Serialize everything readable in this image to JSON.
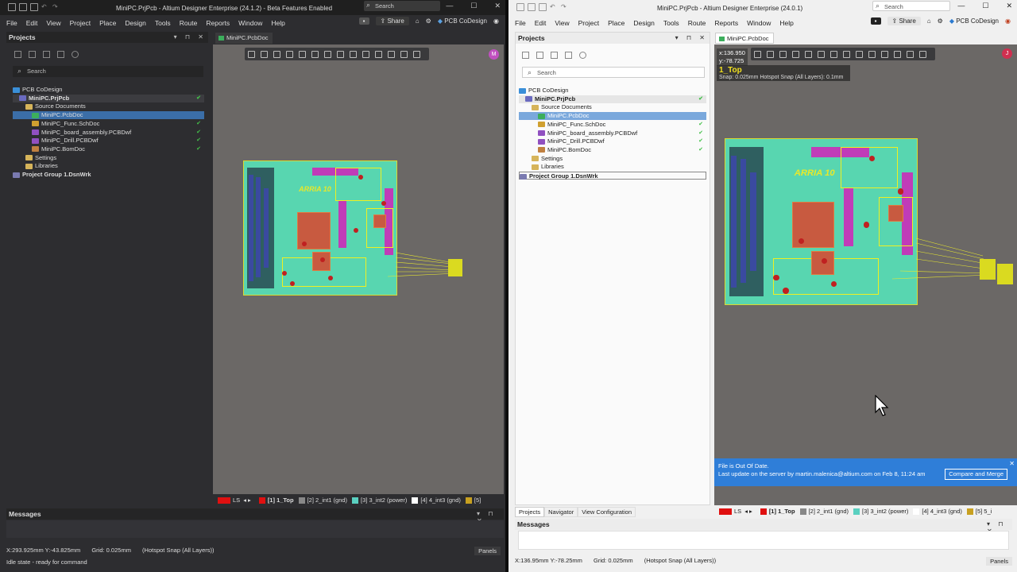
{
  "left": {
    "title": "MiniPC.PrjPcb - Altium Designer Enterprise (24.1.2) - Beta Features Enabled",
    "search_placeholder": "Search",
    "menu": [
      "File",
      "Edit",
      "View",
      "Project",
      "Place",
      "Design",
      "Tools",
      "Route",
      "Reports",
      "Window",
      "Help"
    ],
    "share_label": "Share",
    "codesign_label": "PCB CoDesign",
    "projects_title": "Projects",
    "panel_search": "Search",
    "tree": [
      {
        "label": "PCB CoDesign",
        "indent": 0,
        "icon": "cloud-icon",
        "check": false,
        "selected": false,
        "bold": false
      },
      {
        "label": "MiniPC.PrjPcb",
        "indent": 1,
        "icon": "project-icon",
        "check": true,
        "selected": false,
        "bold": true,
        "highlight": true
      },
      {
        "label": "Source Documents",
        "indent": 2,
        "icon": "folder-icon",
        "check": false,
        "selected": false,
        "bold": false
      },
      {
        "label": "MiniPC.PcbDoc",
        "indent": 3,
        "icon": "pcb-doc-icon",
        "check": false,
        "selected": true,
        "bold": false
      },
      {
        "label": "MiniPC_Func.SchDoc",
        "indent": 3,
        "icon": "sch-doc-icon",
        "check": true,
        "selected": false,
        "bold": false
      },
      {
        "label": "MiniPC_board_assembly.PCBDwf",
        "indent": 3,
        "icon": "draftsman-icon",
        "check": true,
        "selected": false,
        "bold": false
      },
      {
        "label": "MiniPC_Drill.PCBDwf",
        "indent": 3,
        "icon": "draftsman-icon",
        "check": true,
        "selected": false,
        "bold": false
      },
      {
        "label": "MiniPC.BomDoc",
        "indent": 3,
        "icon": "bom-icon",
        "check": true,
        "selected": false,
        "bold": false
      },
      {
        "label": "Settings",
        "indent": 2,
        "icon": "folder-icon",
        "check": false,
        "selected": false,
        "bold": false
      },
      {
        "label": "Libraries",
        "indent": 2,
        "icon": "folder-icon",
        "check": false,
        "selected": false,
        "bold": false
      },
      {
        "label": "Project Group 1.DsnWrk",
        "indent": 0,
        "icon": "workspace-icon",
        "check": false,
        "selected": false,
        "bold": true
      }
    ],
    "doc_tab": "MiniPC.PcbDoc",
    "board_label": "ARRIA 10",
    "avatar": "M",
    "layers": [
      "LS",
      "[1] 1_Top",
      "[2] 2_int1 (gnd)",
      "[3] 3_int2 (power)",
      "[4] 4_int3 (gnd)",
      "[5]"
    ],
    "layer_colors": [
      "#e01010",
      "#e01010",
      "#888888",
      "#5ad0c0",
      "#ffffff",
      "#c8a020"
    ],
    "messages_title": "Messages",
    "status_coords": "X:293.925mm Y:-43.825mm",
    "status_grid": "Grid: 0.025mm",
    "status_snap": "(Hotspot Snap (All Layers))",
    "status_idle": "Idle state - ready for command",
    "panels_btn": "Panels"
  },
  "right": {
    "title": "MiniPC.PrjPcb - Altium Designer Enterprise (24.0.1)",
    "search_placeholder": "Search",
    "menu": [
      "File",
      "Edit",
      "View",
      "Project",
      "Place",
      "Design",
      "Tools",
      "Route",
      "Reports",
      "Window",
      "Help"
    ],
    "share_label": "Share",
    "codesign_label": "PCB CoDesign",
    "projects_title": "Projects",
    "panel_search": "Search",
    "tree": [
      {
        "label": "PCB CoDesign",
        "indent": 0,
        "icon": "cloud-icon",
        "check": false,
        "selected": false,
        "bold": false
      },
      {
        "label": "MiniPC.PrjPcb",
        "indent": 1,
        "icon": "project-icon",
        "check": true,
        "selected": false,
        "bold": true,
        "highlight": true
      },
      {
        "label": "Source Documents",
        "indent": 2,
        "icon": "folder-icon",
        "check": false,
        "selected": false,
        "bold": false
      },
      {
        "label": "MiniPC.PcbDoc",
        "indent": 3,
        "icon": "pcb-doc-icon",
        "check": false,
        "selected": true,
        "bold": false
      },
      {
        "label": "MiniPC_Func.SchDoc",
        "indent": 3,
        "icon": "sch-doc-icon",
        "check": true,
        "selected": false,
        "bold": false
      },
      {
        "label": "MiniPC_board_assembly.PCBDwf",
        "indent": 3,
        "icon": "draftsman-icon",
        "check": true,
        "selected": false,
        "bold": false
      },
      {
        "label": "MiniPC_Drill.PCBDwf",
        "indent": 3,
        "icon": "draftsman-icon",
        "check": true,
        "selected": false,
        "bold": false
      },
      {
        "label": "MiniPC.BomDoc",
        "indent": 3,
        "icon": "bom-icon",
        "check": true,
        "selected": false,
        "bold": false
      },
      {
        "label": "Settings",
        "indent": 2,
        "icon": "folder-icon",
        "check": false,
        "selected": false,
        "bold": false
      },
      {
        "label": "Libraries",
        "indent": 2,
        "icon": "folder-icon",
        "check": false,
        "selected": false,
        "bold": false
      },
      {
        "label": "Project Group 1.DsnWrk",
        "indent": 0,
        "icon": "workspace-icon",
        "check": false,
        "selected": false,
        "bold": true,
        "boxed": true
      }
    ],
    "doc_tab": "MiniPC.PcbDoc",
    "hud_x": "x:136.950",
    "hud_y": "y:-78.725",
    "hud_layer": "1_Top",
    "hud_snap": "Snap: 0.025mm Hotspot Snap (All Layers): 0.1mm",
    "board_label": "ARRIA 10",
    "avatar": "J",
    "notice_line1": "File is Out Of Date.",
    "notice_line2": "Last update on the server by martin.malenica@altium.com on Feb 8, 11:24 am",
    "compare_btn": "Compare and Merge",
    "bottom_tabs": [
      "Projects",
      "Navigator",
      "View Configuration"
    ],
    "layers": [
      "LS",
      "[1] 1_Top",
      "[2] 2_int1 (gnd)",
      "[3] 3_int2 (power)",
      "[4] 4_int3 (gnd)",
      "[5] 5_i"
    ],
    "layer_colors": [
      "#e01010",
      "#e01010",
      "#888888",
      "#5ad0c0",
      "#ffffff",
      "#c8a020"
    ],
    "messages_title": "Messages",
    "status_coords": "X:136.95mm Y:-78.25mm",
    "status_grid": "Grid: 0.025mm",
    "status_snap": "(Hotspot Snap (All Layers))",
    "panels_btn": "Panels"
  }
}
